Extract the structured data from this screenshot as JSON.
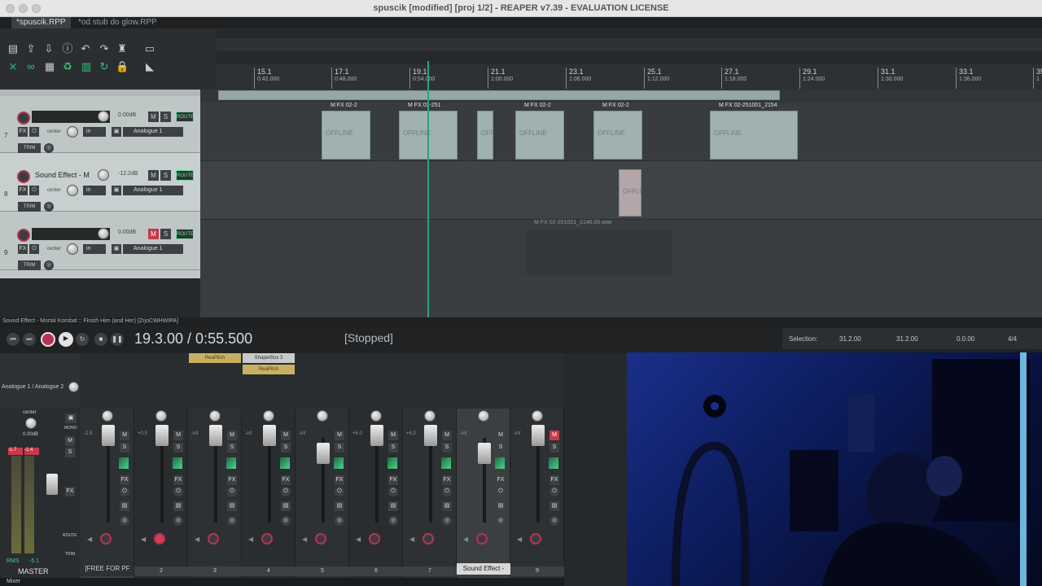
{
  "window": {
    "title": "spuscik [modified] [proj 1/2] - REAPER v7.39 - EVALUATION LICENSE"
  },
  "tabs": [
    {
      "label": "*spuscik.RPP"
    },
    {
      "label": "*od stub do glow.RPP"
    }
  ],
  "ruler": {
    "marks": [
      {
        "bar": "15.1",
        "time": "0:42.000"
      },
      {
        "bar": "17.1",
        "time": "0:48.000"
      },
      {
        "bar": "19.1",
        "time": "0:54.000"
      },
      {
        "bar": "21.1",
        "time": "1:00.000"
      },
      {
        "bar": "23.1",
        "time": "1:06.000"
      },
      {
        "bar": "25.1",
        "time": "1:12.000"
      },
      {
        "bar": "27.1",
        "time": "1:18.000"
      },
      {
        "bar": "29.1",
        "time": "1:24.000"
      },
      {
        "bar": "31.1",
        "time": "1:30.000"
      },
      {
        "bar": "33.1",
        "time": "1:36.000"
      },
      {
        "bar": "35",
        "time": "1"
      }
    ]
  },
  "tracks": [
    {
      "number": "7",
      "name": "",
      "volume": "0.00dB",
      "pan": "center",
      "io": "in",
      "input": "Analogue 1",
      "route": "ROUTE",
      "fx": "FX",
      "trim": "TRIM"
    },
    {
      "number": "8",
      "name": "Sound Effect - M",
      "volume": "-12.2dB",
      "pan": "center",
      "io": "in",
      "input": "Analogue 1",
      "route": "ROUTE",
      "fx": "FX",
      "trim": "TRIM"
    },
    {
      "number": "9",
      "name": "",
      "volume": "0.00dB",
      "pan": "center",
      "io": "in",
      "input": "Analogue 1",
      "route": "ROUTE",
      "fx": "FX",
      "trim": "TRIM"
    }
  ],
  "items": {
    "offline_label": "OFFLINE",
    "off_short": "OFF",
    "header_a": "02-2",
    "header_b": "02-251",
    "header_c": "02-251001_2154",
    "header_d": "02-251001_2146.00.wav",
    "mute": "M",
    "fx": "FX"
  },
  "status_line": "Sound Effect - Mortal Kombat :: Finish Him (and Her) [ZrjoCWHWIPA]",
  "transport": {
    "position": "19.3.00 / 0:55.500",
    "state": "[Stopped]",
    "selection_label": "Selection:",
    "sel_start": "31.2.00",
    "sel_end": "31.2.00",
    "sel_len": "0.0.00",
    "time_sig": "4/4"
  },
  "mixer": {
    "input_label": "Analogue 1 / Analogue 2",
    "master": {
      "pan": "center",
      "volume": "0.00dB",
      "peak_l": "-1.7",
      "peak_r": "-1.4",
      "rms_label": "RMS",
      "rms": "-5.1",
      "name": "MASTER",
      "buttons": [
        "MONO",
        "M",
        "S",
        "FX",
        "ROUTE",
        "TRIM"
      ]
    },
    "fx_slots": [
      {
        "strip": 2,
        "label": "ReaPitch"
      },
      {
        "strip": 3,
        "label": "ShaperBox 3"
      },
      {
        "strip": 3,
        "label": "ReaPitch"
      }
    ],
    "strips": [
      {
        "num": "1",
        "peak": "-2.9",
        "name": "[FREE FOR PF"
      },
      {
        "num": "2",
        "peak": "+0.9",
        "name": ""
      },
      {
        "num": "3",
        "peak": "-inf",
        "name": ""
      },
      {
        "num": "4",
        "peak": "-inf",
        "name": ""
      },
      {
        "num": "5",
        "peak": "-inf",
        "name": ""
      },
      {
        "num": "6",
        "peak": "+6.0",
        "name": ""
      },
      {
        "num": "7",
        "peak": "+6.0",
        "name": ""
      },
      {
        "num": "8",
        "peak": "-inf",
        "name": "Sound Effect -"
      },
      {
        "num": "9",
        "peak": "-inf",
        "name": ""
      }
    ],
    "mute": "M",
    "solo": "S",
    "fx": "FX"
  },
  "bottom": {
    "label": "Mixer"
  }
}
